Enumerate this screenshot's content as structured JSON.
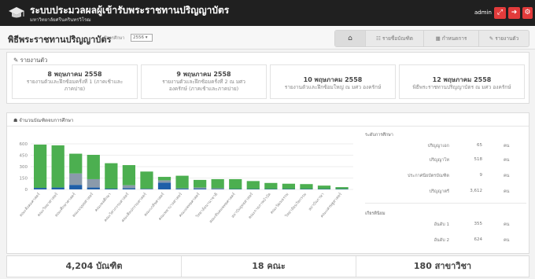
{
  "app": {
    "title": "ระบบประมวลผลผู้เข้ารับพระราชทานปริญญาบัตร",
    "subtitle": "มหาวิทยาลัยศรีนครินทรวิโรฒ",
    "user": "admin",
    "logo_icon": "graduation-cap-icon",
    "buttons": [
      {
        "icon": "expand-icon",
        "glyph": "⤢",
        "color": "#e23b3b"
      },
      {
        "icon": "logout-icon",
        "glyph": "➜",
        "color": "#e23b3b"
      },
      {
        "icon": "gear-icon",
        "glyph": "⚙",
        "color": "#e23b3b"
      }
    ]
  },
  "header": {
    "title": "พิธีพระราชทานปริญญาบัตร",
    "year_label": "ปีการศึกษา",
    "year_value": "2556",
    "tabs": [
      {
        "label": "⌂",
        "icon": "home-icon",
        "active": true
      },
      {
        "label": "☷ รายชื่อบัณฑิต",
        "icon": "list-icon"
      },
      {
        "label": "▦ กำหนดการ",
        "icon": "calendar-icon"
      },
      {
        "label": "✎ รายงานตัว",
        "icon": "edit-icon"
      }
    ]
  },
  "report": {
    "heading": "✎ รายงานตัว",
    "cards": [
      {
        "date": "8 พฤษภาคม 2558",
        "desc1": "รายงานตัวและฝึกซ้อมครั้งที่ 1 (ภาคเช้าและ",
        "desc2": "ภาคบ่าย)"
      },
      {
        "date": "9 พฤษภาคม 2558",
        "desc1": "รายงานตัวและฝึกซ้อมครั้งที่ 2 ณ มศว",
        "desc2": "องครักษ์ (ภาคเช้าและภาคบ่าย)"
      },
      {
        "date": "10 พฤษภาคม 2558",
        "desc1": "รายงานตัวและฝึกซ้อมใหญ่ ณ มศว องครักษ์",
        "desc2": ""
      },
      {
        "date": "12 พฤษภาคม 2558",
        "desc1": "พิธีพระราชทานปริญญาบัตร ณ มศว องครักษ์",
        "desc2": ""
      }
    ]
  },
  "chart_section": {
    "heading": "☗ จำนวนบัณฑิตจบการศึกษา"
  },
  "chart_data": {
    "type": "bar",
    "stacked": true,
    "ylim": [
      0,
      600
    ],
    "yticks": [
      "600",
      "450",
      "300",
      "150",
      "0"
    ],
    "categories": [
      "คณะสังคมศาสตร์",
      "คณะวิทยาศาสตร์",
      "คณะศึกษาศาสตร์",
      "คณะมนุษยศาสตร์",
      "คณะพลศึกษา",
      "คณะวิศวกรรมศาสตร์",
      "คณะศิลปกรรมศาสตร์",
      "คณะเภสัชศาสตร์",
      "คณะพยาบาลศาสตร์",
      "คณะแพทยศาสตร์",
      "วิทยาลัยนานาชาติ",
      "คณะทันตแพทยศาสตร์",
      "สถาบันยุทธศาสตร์",
      "คณะกายภาพบำบัด",
      "คณะวัฒนธรรม",
      "วิทยาลัยนวัตกรรม",
      "สถาบันภาษา",
      "คณะเศรษฐศาสตร์"
    ],
    "series": [
      {
        "color": "#1f5fa8",
        "values": [
          20,
          25,
          60,
          25,
          10,
          15,
          5,
          90,
          10,
          10,
          5,
          5,
          5,
          5,
          5,
          5,
          5,
          5
        ]
      },
      {
        "color": "#8a9aab",
        "values": [
          0,
          0,
          150,
          110,
          0,
          40,
          5,
          30,
          5,
          15,
          10,
          0,
          0,
          0,
          0,
          0,
          0,
          0
        ]
      },
      {
        "color": "#4caf50",
        "values": [
          570,
          555,
          260,
          320,
          335,
          265,
          225,
          45,
          165,
          100,
          120,
          130,
          105,
          80,
          70,
          65,
          45,
          25
        ]
      }
    ]
  },
  "side": {
    "levels_head": "ระดับการศึกษา",
    "levels": [
      {
        "label": "ปริญญาเอก",
        "value": "65",
        "unit": "คน"
      },
      {
        "label": "ปริญญาโท",
        "value": "518",
        "unit": "คน"
      },
      {
        "label": "ประกาศนียบัตรบัณฑิต",
        "value": "9",
        "unit": "คน"
      },
      {
        "label": "ปริญญาตรี",
        "value": "3,612",
        "unit": "คน"
      }
    ],
    "honors_head": "เกียรตินิยม",
    "honors": [
      {
        "label": "อันดับ 1",
        "value": "355",
        "unit": "คน"
      },
      {
        "label": "อันดับ 2",
        "value": "624",
        "unit": "คน"
      }
    ]
  },
  "stats": [
    "4,204 บัณฑิต",
    "18 คณะ",
    "180 สาขาวิชา"
  ]
}
